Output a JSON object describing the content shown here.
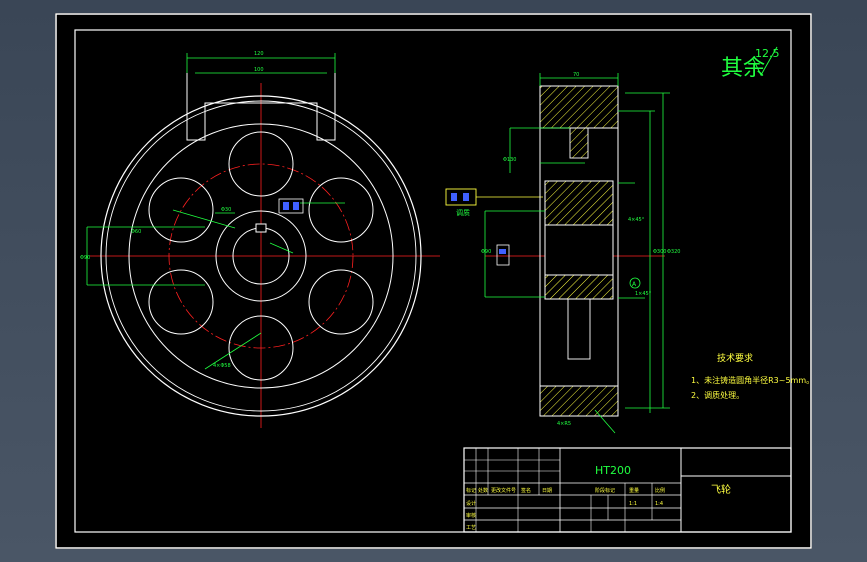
{
  "drawing": {
    "roughness": {
      "prefix": "其余",
      "value": "12.5"
    },
    "material": "HT200",
    "part_name": "飞轮",
    "tech_req": {
      "title": "技术要求",
      "items": [
        "1、未注铸造圆角半径R3~5mm。",
        "2、调质处理。"
      ]
    },
    "callout_left": "调质",
    "titleblock": {
      "scale": "1:4",
      "sheet": "1:1",
      "row_labels": [
        "设计",
        "审核",
        "工艺"
      ],
      "col_labels": [
        "标记",
        "处数",
        "更改文件号",
        "签名",
        "日期"
      ],
      "stage_labels": [
        "阶段标记",
        "重量",
        "比例"
      ]
    }
  },
  "colors": {
    "frame": "#ffffff",
    "outline": "#ffffff",
    "center": "#ff2020",
    "dim": "#20ff40",
    "hatch": "#ffff40",
    "text": "#ffff40",
    "accent": "#4060ff"
  }
}
